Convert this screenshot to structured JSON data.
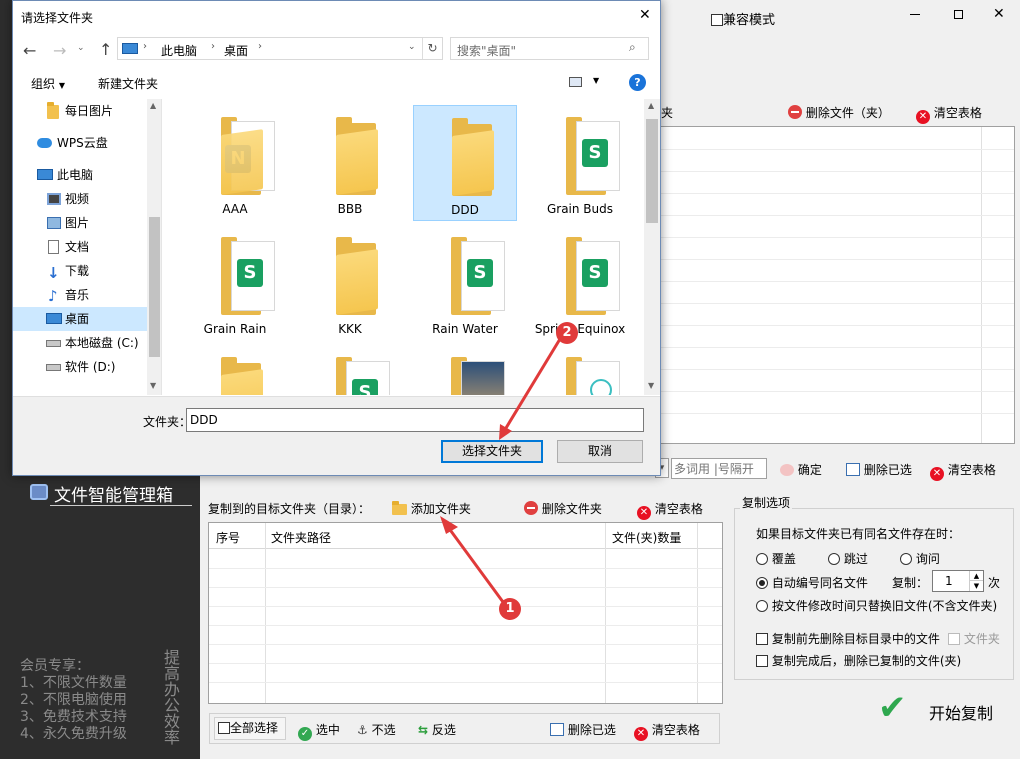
{
  "app": {
    "compat_label": "兼容模式",
    "brand_title": "文件智能管理箱",
    "top_toolbar": {
      "delete_label": "删除文件（夹）",
      "clear_label": "清空表格",
      "partial_col": "夹"
    },
    "filter": {
      "placeholder": "多词用 |号隔开",
      "confirm_label": "确定",
      "delete_selected_label": "删除已选",
      "clear_label": "清空表格"
    },
    "target": {
      "title": "复制到的目标文件夹（目录）：",
      "add_label": "添加文件夹",
      "delete_label": "删除文件夹",
      "clear_label": "清空表格",
      "columns": [
        "序号",
        "文件夹路径",
        "文件(夹)数量"
      ]
    },
    "bottom_toolbar": {
      "select_all": "全部选择",
      "select": "选中",
      "unselect": "不选",
      "invert": "反选",
      "delete_selected": "删除已选",
      "clear": "清空表格"
    },
    "options": {
      "title": "复制选项",
      "question": "如果目标文件夹已有同名文件存在时：",
      "overwrite": "覆盖",
      "skip": "跳过",
      "ask": "询问",
      "auto_number": "自动编号同名文件",
      "copy_label": "复制：",
      "copy_count": "1",
      "copy_unit": "次",
      "replace_old": "按文件修改时间只替换旧文件(不含文件夹)",
      "delete_before": "复制前先删除目标目录中的文件",
      "folder_opt": "文件夹",
      "delete_after": "复制完成后，删除已复制的文件(夹)"
    },
    "start_label": "开始复制",
    "member": {
      "title": "会员专享：",
      "items": [
        "1、不限文件数量",
        "2、不限电脑使用",
        "3、免费技术支持",
        "4、永久免费升级"
      ]
    },
    "vertical_slogan": "提高办公效率"
  },
  "dialog": {
    "title": "请选择文件夹",
    "breadcrumb": [
      "此电脑",
      "桌面"
    ],
    "search_placeholder": "搜索\"桌面\"",
    "organize_label": "组织",
    "new_folder_label": "新建文件夹",
    "nav_items": [
      {
        "label": "每日图片",
        "icon": "folder-icon"
      },
      {
        "label": "WPS云盘",
        "icon": "cloud-icon"
      },
      {
        "label": "此电脑",
        "icon": "computer-icon"
      },
      {
        "label": "视频",
        "icon": "video-icon"
      },
      {
        "label": "图片",
        "icon": "picture-icon"
      },
      {
        "label": "文档",
        "icon": "document-icon"
      },
      {
        "label": "下载",
        "icon": "download-icon"
      },
      {
        "label": "音乐",
        "icon": "music-icon"
      },
      {
        "label": "桌面",
        "icon": "desktop-icon"
      },
      {
        "label": "本地磁盘 (C:)",
        "icon": "drive-icon"
      },
      {
        "label": "软件 (D:)",
        "icon": "drive-icon"
      }
    ],
    "folders": [
      "AAA",
      "BBB",
      "DDD",
      "Grain Buds",
      "Grain Rain",
      "KKK",
      "Rain Water",
      "Spring Equinox"
    ],
    "folder_field_label": "文件夹：",
    "folder_field_value": "DDD",
    "select_button": "选择文件夹",
    "cancel_button": "取消"
  },
  "annotations": {
    "step1": "1",
    "step2": "2"
  },
  "colors": {
    "accent_red": "#e03a3a",
    "selected_tile": "#cce8ff",
    "sidebar_bg": "#2d2d2d"
  }
}
